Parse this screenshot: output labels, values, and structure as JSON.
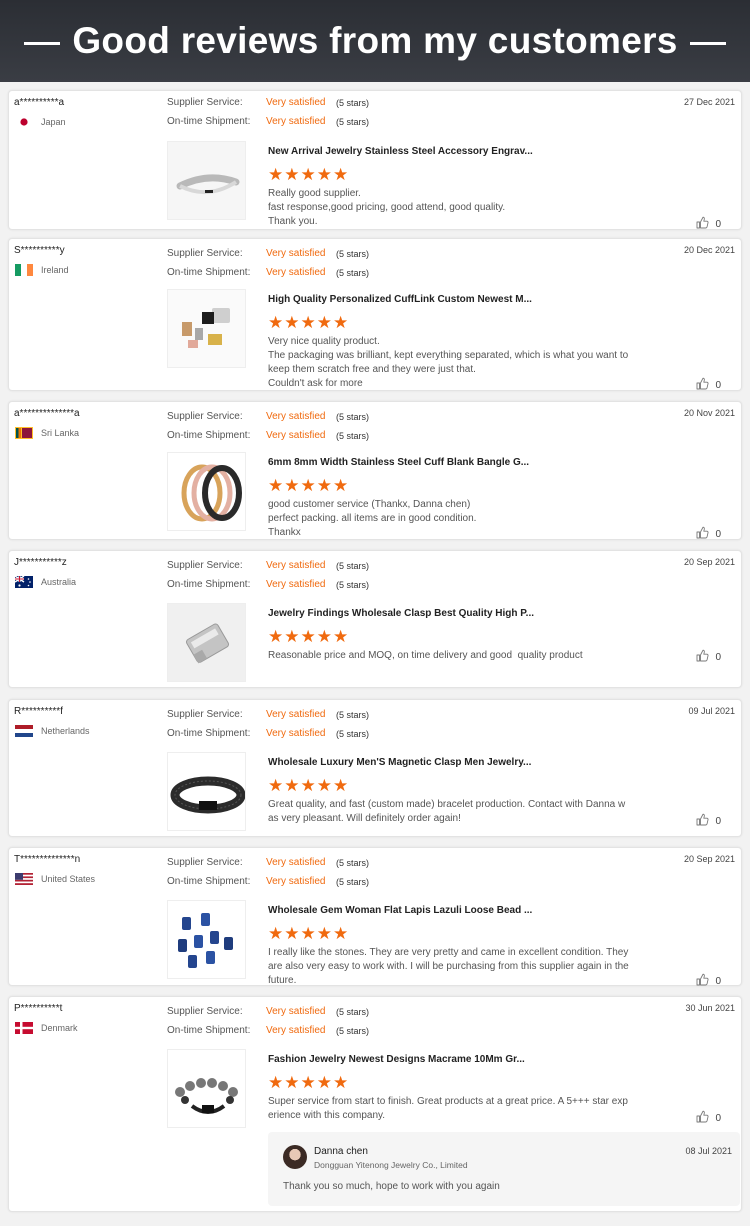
{
  "banner": {
    "title": "Good reviews from my customers"
  },
  "labels": {
    "supplier_service": "Supplier Service:",
    "on_time_shipment": "On-time Shipment:",
    "satisfied": "Very satisfied",
    "stars": "(5 stars)",
    "star_glyphs": "★★★★★"
  },
  "colors": {
    "accent": "#f06a0f",
    "banner_bg": "#2b2e34"
  },
  "reviews": [
    {
      "user": "a**********a",
      "country": "Japan",
      "flag": "japan",
      "date": "27 Dec 2021",
      "product": "New Arrival Jewelry Stainless Steel Accessory Engrav...",
      "text": "Really good supplier.\nfast response,good pricing, good attend, good quality.\nThank you.",
      "likes": "0",
      "rating": 5,
      "thumb": "cuff"
    },
    {
      "user": "S**********y",
      "country": "Ireland",
      "flag": "ireland",
      "date": "20 Dec 2021",
      "product": "High Quality Personalized CuffLink Custom Newest M...",
      "text": "Very nice quality product.\nThe packaging was brilliant, kept everything separated, which is what you want to\nkeep them scratch free and they were just that.\nCouldn't ask for more",
      "likes": "0",
      "rating": 5,
      "thumb": "cufflinks"
    },
    {
      "user": "a**************a",
      "country": "Sri Lanka",
      "flag": "srilanka",
      "date": "20 Nov 2021",
      "product": "6mm 8mm Width Stainless Steel Cuff Blank Bangle G...",
      "text": "good customer service (Thankx, Danna chen)\nperfect packing. all items are in good condition.\nThankx",
      "likes": "0",
      "rating": 5,
      "thumb": "bangles"
    },
    {
      "user": "J***********z",
      "country": "Australia",
      "flag": "australia",
      "date": "20 Sep 2021",
      "product": "Jewelry Findings Wholesale Clasp Best Quality High P...",
      "text": "Reasonable price and MOQ, on time delivery and good  quality product",
      "likes": "0",
      "rating": 5,
      "thumb": "clasp"
    },
    {
      "user": "R**********f",
      "country": "Netherlands",
      "flag": "netherlands",
      "date": "09 Jul 2021",
      "product": "Wholesale Luxury Men'S Magnetic Clasp Men Jewelry...",
      "text": "Great quality, and fast (custom made) bracelet production. Contact with Danna w\nas very pleasant. Will definitely order again!",
      "likes": "0",
      "rating": 5,
      "thumb": "leather"
    },
    {
      "user": "T**************n",
      "country": "United States",
      "flag": "usa",
      "date": "20 Sep 2021",
      "product": "Wholesale Gem Woman Flat Lapis Lazuli Loose Bead ...",
      "text": "I really like the stones. They are very pretty and came in excellent condition. They\nare also very easy to work with. I will be purchasing from this supplier again in the\nfuture.",
      "likes": "0",
      "rating": 5,
      "thumb": "lapis"
    },
    {
      "user": "P**********t",
      "country": "Denmark",
      "flag": "denmark",
      "date": "30 Jun 2021",
      "product": "Fashion Jewelry Newest Designs Macrame 10Mm Gr...",
      "text": "Super service from start to finish. Great products at a great price. A 5+++ star exp\nerience with this company.",
      "likes": "0",
      "rating": 5,
      "thumb": "macrame"
    }
  ],
  "reply": {
    "name": "Danna chen",
    "company": "Dongguan Yitenong Jewelry Co., Limited",
    "date": "08 Jul 2021",
    "message": "Thank you so much, hope to work with you again"
  }
}
